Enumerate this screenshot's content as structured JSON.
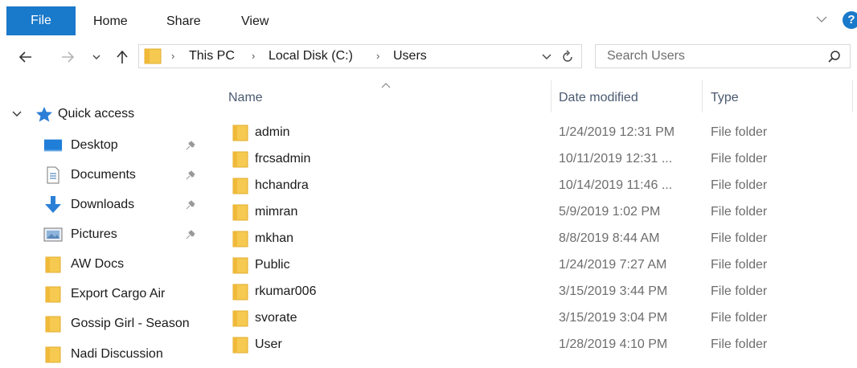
{
  "ribbon": {
    "tabs": [
      "File",
      "Home",
      "Share",
      "View"
    ]
  },
  "nav": {
    "breadcrumb": [
      "This PC",
      "Local Disk (C:)",
      "Users"
    ],
    "search_placeholder": "Search Users"
  },
  "columns": {
    "name": "Name",
    "date": "Date modified",
    "type": "Type"
  },
  "sidebar": {
    "quick_access": "Quick access",
    "items": [
      {
        "label": "Desktop",
        "icon": "desktop-icon",
        "pinned": true
      },
      {
        "label": "Documents",
        "icon": "documents-icon",
        "pinned": true
      },
      {
        "label": "Downloads",
        "icon": "downloads-icon",
        "pinned": true
      },
      {
        "label": "Pictures",
        "icon": "pictures-icon",
        "pinned": true
      },
      {
        "label": "AW Docs",
        "icon": "folder-icon",
        "pinned": false
      },
      {
        "label": "Export Cargo Air",
        "icon": "folder-icon",
        "pinned": false
      },
      {
        "label": "Gossip Girl - Season",
        "icon": "folder-icon",
        "pinned": false
      },
      {
        "label": "Nadi Discussion",
        "icon": "folder-icon",
        "pinned": false
      }
    ]
  },
  "files": [
    {
      "name": "admin",
      "date": "1/24/2019 12:31 PM",
      "type": "File folder"
    },
    {
      "name": "frcsadmin",
      "date": "10/11/2019 12:31 ...",
      "type": "File folder"
    },
    {
      "name": "hchandra",
      "date": "10/14/2019 11:46 ...",
      "type": "File folder"
    },
    {
      "name": "mimran",
      "date": "5/9/2019 1:02 PM",
      "type": "File folder"
    },
    {
      "name": "mkhan",
      "date": "8/8/2019 8:44 AM",
      "type": "File folder"
    },
    {
      "name": "Public",
      "date": "1/24/2019 7:27 AM",
      "type": "File folder"
    },
    {
      "name": "rkumar006",
      "date": "3/15/2019 3:44 PM",
      "type": "File folder"
    },
    {
      "name": "svorate",
      "date": "3/15/2019 3:04 PM",
      "type": "File folder"
    },
    {
      "name": "User",
      "date": "1/28/2019 4:10 PM",
      "type": "File folder"
    }
  ],
  "colors": {
    "accent": "#1979ca",
    "folder": "#f6c950",
    "header_text": "#4a5a70"
  }
}
